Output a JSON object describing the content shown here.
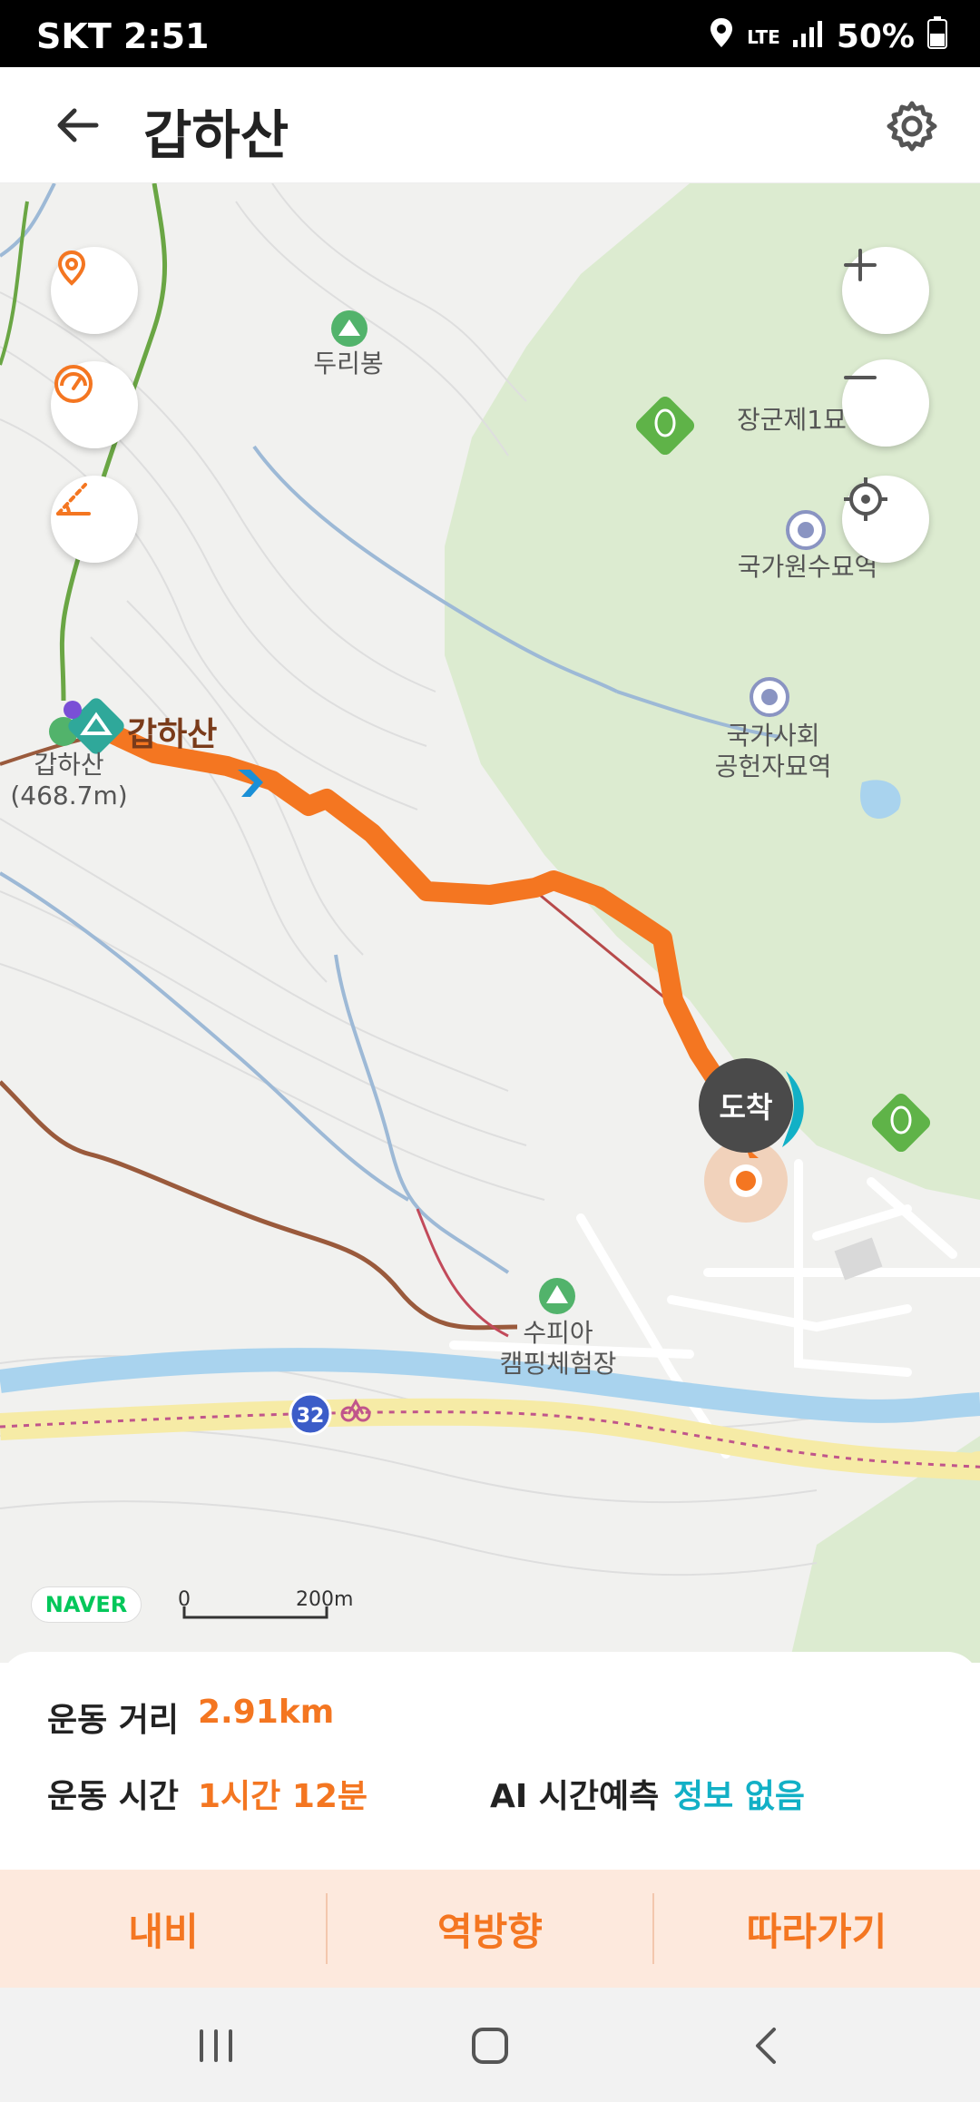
{
  "status_bar": {
    "carrier_time": "SKT 2:51",
    "network": "LTE",
    "battery": "50%"
  },
  "header": {
    "title": "갑하산"
  },
  "map": {
    "labels": {
      "peak_duri": "두리봉",
      "janggun": "장군제1묘",
      "national_cemetery_station": "국가원수묘역",
      "social_merit_line1": "국가사회",
      "social_merit_line2": "공헌자묘역",
      "summit_name": "갑하산",
      "summit_small_line1": "갑하산",
      "summit_small_line2": "(468.7m)",
      "camping_line1": "수피아",
      "camping_line2": "캠핑체험장",
      "road_number": "32"
    },
    "arrival_label": "도착",
    "logo": "NAVER",
    "scale_start": "0",
    "scale_end": "200m",
    "colors": {
      "route": "#f47621",
      "park": "#dcebd0",
      "river": "#a9d3ee",
      "road_yellow": "#f6eba6"
    }
  },
  "stats": {
    "distance_label": "운동 거리",
    "distance_value": "2.91km",
    "time_label": "운동 시간",
    "time_value": "1시간 12분",
    "ai_label": "AI 시간예측",
    "ai_value": "정보 없음",
    "accent_orange": "#f47621",
    "accent_teal": "#12b0c6"
  },
  "actions": {
    "navi": "내비",
    "reverse": "역방향",
    "follow": "따라가기"
  }
}
